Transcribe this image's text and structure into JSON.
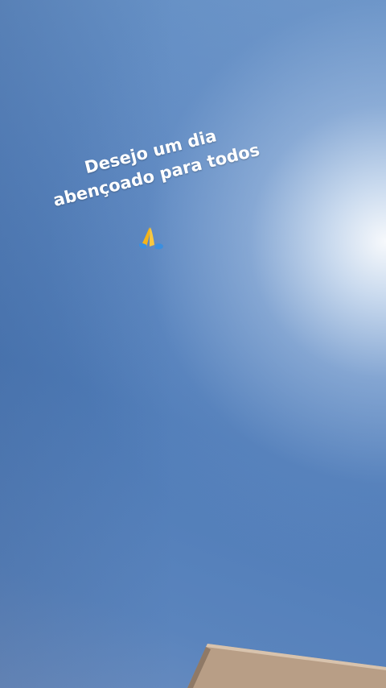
{
  "story": {
    "caption_line1": "Desejo um dia",
    "caption_line2": "abençoado para todos",
    "emoji_icon": "folded-hands-icon"
  },
  "colors": {
    "sky": "#4f7cb7",
    "sun_glare": "#ffffff",
    "caption_text": "#ffffff",
    "building": "#b89e86"
  }
}
